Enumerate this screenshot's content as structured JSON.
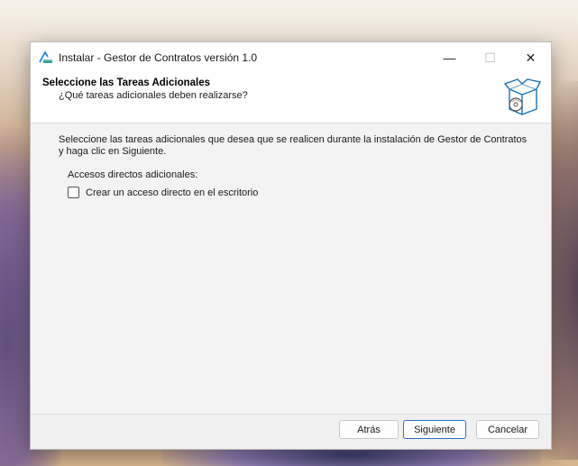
{
  "window": {
    "title": "Instalar - Gestor de Contratos versión 1.0",
    "controls": {
      "minimize": "—",
      "maximize": "☐",
      "close": "✕"
    }
  },
  "header": {
    "title": "Seleccione las Tareas Adicionales",
    "subtitle": "¿Qué tareas adicionales deben realizarse?",
    "icon": "installer-box-icon"
  },
  "content": {
    "description": "Seleccione las tareas adicionales que desea que se realicen durante la instalación de Gestor de Contratos y haga clic en Siguiente.",
    "section_label": "Accesos directos adicionales:",
    "tasks": [
      {
        "label": "Crear un acceso directo en el escritorio",
        "checked": false
      }
    ]
  },
  "footer": {
    "back_label": "Atrás",
    "next_label": "Siguiente",
    "cancel_label": "Cancelar"
  },
  "colors": {
    "accent": "#2e6fc4"
  }
}
